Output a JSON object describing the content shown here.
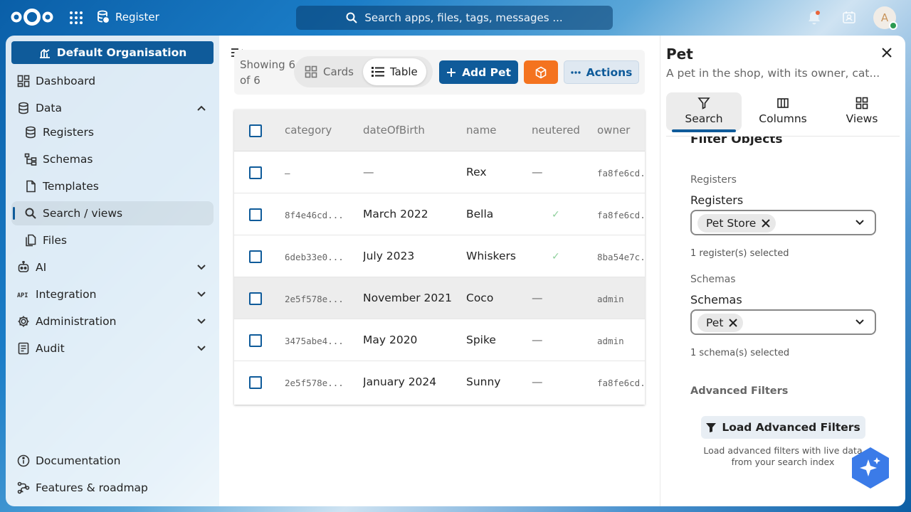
{
  "topbar": {
    "app_name": "Register",
    "search_placeholder": "Search apps, files, tags, messages ...",
    "avatar_initial": "A"
  },
  "sidebar": {
    "organisation": "Default Organisation",
    "items": [
      {
        "label": "Dashboard",
        "icon": "dashboard-icon"
      },
      {
        "label": "Data",
        "icon": "database-icon",
        "expanded": true
      },
      {
        "label": "Registers",
        "icon": "database-icon",
        "sub": true
      },
      {
        "label": "Schemas",
        "icon": "schema-tree-icon",
        "sub": true
      },
      {
        "label": "Templates",
        "icon": "file-icon",
        "sub": true
      },
      {
        "label": "Search / views",
        "icon": "search-icon",
        "sub": true,
        "active": true
      },
      {
        "label": "Files",
        "icon": "files-icon",
        "sub": true
      },
      {
        "label": "AI",
        "icon": "robot-icon"
      },
      {
        "label": "Integration",
        "icon": "api-icon"
      },
      {
        "label": "Administration",
        "icon": "gear-icon"
      },
      {
        "label": "Audit",
        "icon": "audit-icon"
      }
    ],
    "footer": [
      {
        "label": "Documentation",
        "icon": "info-icon"
      },
      {
        "label": "Features & roadmap",
        "icon": "roadmap-icon"
      }
    ]
  },
  "toolbar": {
    "showing": "Showing 6 of 6",
    "view_cards": "Cards",
    "view_table": "Table",
    "add_label": "Add Pet",
    "actions_label": "Actions"
  },
  "table": {
    "headers": [
      "category",
      "dateOfBirth",
      "name",
      "neutered",
      "owner"
    ],
    "rows": [
      {
        "category": "–",
        "dateOfBirth": "—",
        "name": "Rex",
        "neutered": "—",
        "owner": "fa8fe6cd..."
      },
      {
        "category": "8f4e46cd...",
        "dateOfBirth": "March 2022",
        "name": "Bella",
        "neutered": "✓",
        "owner": "fa8fe6cd..."
      },
      {
        "category": "6deb33e0...",
        "dateOfBirth": "July 2023",
        "name": "Whiskers",
        "neutered": "✓",
        "owner": "8ba54e7c..."
      },
      {
        "category": "2e5f578e...",
        "dateOfBirth": "November 2021",
        "name": "Coco",
        "neutered": "—",
        "owner": "admin"
      },
      {
        "category": "3475abe4...",
        "dateOfBirth": "May 2020",
        "name": "Spike",
        "neutered": "—",
        "owner": "admin"
      },
      {
        "category": "2e5f578e...",
        "dateOfBirth": "January 2024",
        "name": "Sunny",
        "neutered": "—",
        "owner": "fa8fe6cd..."
      }
    ]
  },
  "panel": {
    "title": "Pet",
    "subtitle": "A pet in the shop, with its owner, cat...",
    "tabs": [
      "Search",
      "Columns",
      "Views"
    ],
    "section_heading": "Filter Objects",
    "registers_small": "Registers",
    "registers_label": "Registers",
    "registers_chip": "Pet Store",
    "registers_hint": "1 register(s) selected",
    "schemas_small": "Schemas",
    "schemas_label": "Schemas",
    "schemas_chip": "Pet",
    "schemas_hint": "1 schema(s) selected",
    "advanced_heading": "Advanced Filters",
    "load_button": "Load Advanced Filters",
    "load_hint_1": "Load advanced filters with live data",
    "load_hint_2": "from your search index"
  },
  "colors": {
    "primary": "#0f5b9a",
    "orange": "#f4731f",
    "check_green": "#8fd09c"
  }
}
